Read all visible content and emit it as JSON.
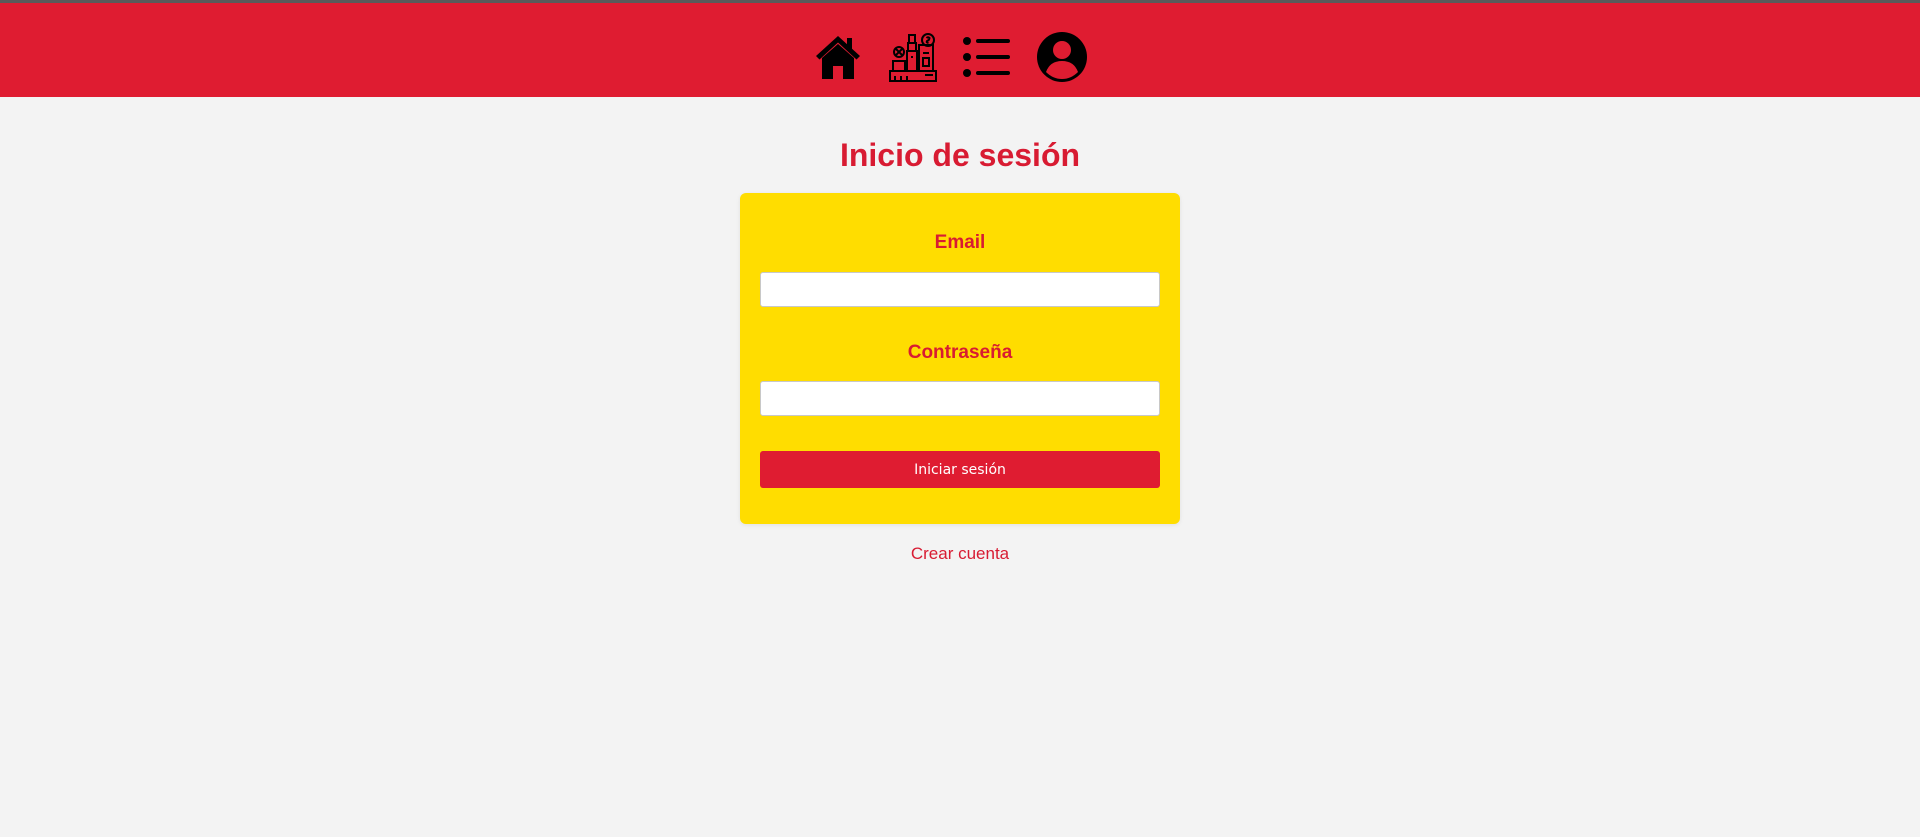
{
  "nav": {
    "icons": [
      "home-icon",
      "products-icon",
      "list-icon",
      "account-icon"
    ]
  },
  "page": {
    "title": "Inicio de sesión"
  },
  "form": {
    "email_label": "Email",
    "email_value": "",
    "password_label": "Contraseña",
    "password_value": "",
    "submit_label": "Iniciar sesión"
  },
  "links": {
    "create_account": "Crear cuenta"
  },
  "colors": {
    "brand_red": "#df1c31",
    "card_yellow": "#ffdd00",
    "background": "#f3f3f3"
  }
}
